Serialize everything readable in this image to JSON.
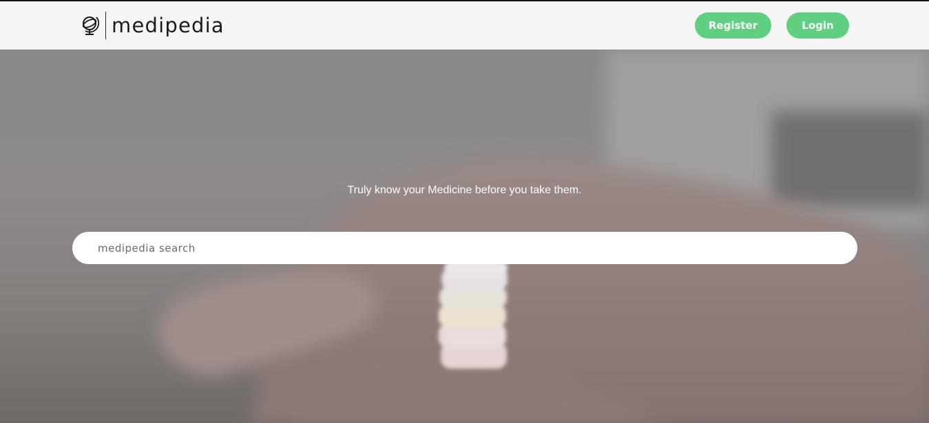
{
  "header": {
    "brand_name": "medipedia",
    "logo_icon": "globe-stand-icon",
    "register_label": "Register",
    "login_label": "Login",
    "accent_color": "#5fcf80"
  },
  "hero": {
    "tagline": "Truly know your Medicine before you take them.",
    "background_image": "hand-holding-pill-stack-photo"
  },
  "search": {
    "placeholder": "medipedia search",
    "value": ""
  }
}
